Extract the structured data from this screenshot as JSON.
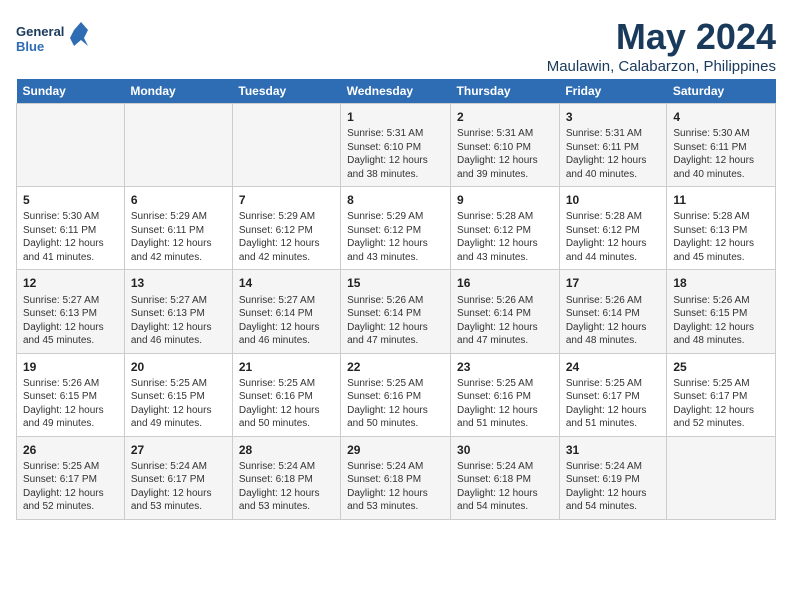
{
  "logo": {
    "line1": "General",
    "line2": "Blue"
  },
  "title": "May 2024",
  "location": "Maulawin, Calabarzon, Philippines",
  "weekdays": [
    "Sunday",
    "Monday",
    "Tuesday",
    "Wednesday",
    "Thursday",
    "Friday",
    "Saturday"
  ],
  "weeks": [
    [
      {
        "day": "",
        "info": ""
      },
      {
        "day": "",
        "info": ""
      },
      {
        "day": "",
        "info": ""
      },
      {
        "day": "1",
        "info": "Sunrise: 5:31 AM\nSunset: 6:10 PM\nDaylight: 12 hours\nand 38 minutes."
      },
      {
        "day": "2",
        "info": "Sunrise: 5:31 AM\nSunset: 6:10 PM\nDaylight: 12 hours\nand 39 minutes."
      },
      {
        "day": "3",
        "info": "Sunrise: 5:31 AM\nSunset: 6:11 PM\nDaylight: 12 hours\nand 40 minutes."
      },
      {
        "day": "4",
        "info": "Sunrise: 5:30 AM\nSunset: 6:11 PM\nDaylight: 12 hours\nand 40 minutes."
      }
    ],
    [
      {
        "day": "5",
        "info": "Sunrise: 5:30 AM\nSunset: 6:11 PM\nDaylight: 12 hours\nand 41 minutes."
      },
      {
        "day": "6",
        "info": "Sunrise: 5:29 AM\nSunset: 6:11 PM\nDaylight: 12 hours\nand 42 minutes."
      },
      {
        "day": "7",
        "info": "Sunrise: 5:29 AM\nSunset: 6:12 PM\nDaylight: 12 hours\nand 42 minutes."
      },
      {
        "day": "8",
        "info": "Sunrise: 5:29 AM\nSunset: 6:12 PM\nDaylight: 12 hours\nand 43 minutes."
      },
      {
        "day": "9",
        "info": "Sunrise: 5:28 AM\nSunset: 6:12 PM\nDaylight: 12 hours\nand 43 minutes."
      },
      {
        "day": "10",
        "info": "Sunrise: 5:28 AM\nSunset: 6:12 PM\nDaylight: 12 hours\nand 44 minutes."
      },
      {
        "day": "11",
        "info": "Sunrise: 5:28 AM\nSunset: 6:13 PM\nDaylight: 12 hours\nand 45 minutes."
      }
    ],
    [
      {
        "day": "12",
        "info": "Sunrise: 5:27 AM\nSunset: 6:13 PM\nDaylight: 12 hours\nand 45 minutes."
      },
      {
        "day": "13",
        "info": "Sunrise: 5:27 AM\nSunset: 6:13 PM\nDaylight: 12 hours\nand 46 minutes."
      },
      {
        "day": "14",
        "info": "Sunrise: 5:27 AM\nSunset: 6:14 PM\nDaylight: 12 hours\nand 46 minutes."
      },
      {
        "day": "15",
        "info": "Sunrise: 5:26 AM\nSunset: 6:14 PM\nDaylight: 12 hours\nand 47 minutes."
      },
      {
        "day": "16",
        "info": "Sunrise: 5:26 AM\nSunset: 6:14 PM\nDaylight: 12 hours\nand 47 minutes."
      },
      {
        "day": "17",
        "info": "Sunrise: 5:26 AM\nSunset: 6:14 PM\nDaylight: 12 hours\nand 48 minutes."
      },
      {
        "day": "18",
        "info": "Sunrise: 5:26 AM\nSunset: 6:15 PM\nDaylight: 12 hours\nand 48 minutes."
      }
    ],
    [
      {
        "day": "19",
        "info": "Sunrise: 5:26 AM\nSunset: 6:15 PM\nDaylight: 12 hours\nand 49 minutes."
      },
      {
        "day": "20",
        "info": "Sunrise: 5:25 AM\nSunset: 6:15 PM\nDaylight: 12 hours\nand 49 minutes."
      },
      {
        "day": "21",
        "info": "Sunrise: 5:25 AM\nSunset: 6:16 PM\nDaylight: 12 hours\nand 50 minutes."
      },
      {
        "day": "22",
        "info": "Sunrise: 5:25 AM\nSunset: 6:16 PM\nDaylight: 12 hours\nand 50 minutes."
      },
      {
        "day": "23",
        "info": "Sunrise: 5:25 AM\nSunset: 6:16 PM\nDaylight: 12 hours\nand 51 minutes."
      },
      {
        "day": "24",
        "info": "Sunrise: 5:25 AM\nSunset: 6:17 PM\nDaylight: 12 hours\nand 51 minutes."
      },
      {
        "day": "25",
        "info": "Sunrise: 5:25 AM\nSunset: 6:17 PM\nDaylight: 12 hours\nand 52 minutes."
      }
    ],
    [
      {
        "day": "26",
        "info": "Sunrise: 5:25 AM\nSunset: 6:17 PM\nDaylight: 12 hours\nand 52 minutes."
      },
      {
        "day": "27",
        "info": "Sunrise: 5:24 AM\nSunset: 6:17 PM\nDaylight: 12 hours\nand 53 minutes."
      },
      {
        "day": "28",
        "info": "Sunrise: 5:24 AM\nSunset: 6:18 PM\nDaylight: 12 hours\nand 53 minutes."
      },
      {
        "day": "29",
        "info": "Sunrise: 5:24 AM\nSunset: 6:18 PM\nDaylight: 12 hours\nand 53 minutes."
      },
      {
        "day": "30",
        "info": "Sunrise: 5:24 AM\nSunset: 6:18 PM\nDaylight: 12 hours\nand 54 minutes."
      },
      {
        "day": "31",
        "info": "Sunrise: 5:24 AM\nSunset: 6:19 PM\nDaylight: 12 hours\nand 54 minutes."
      },
      {
        "day": "",
        "info": ""
      }
    ]
  ]
}
